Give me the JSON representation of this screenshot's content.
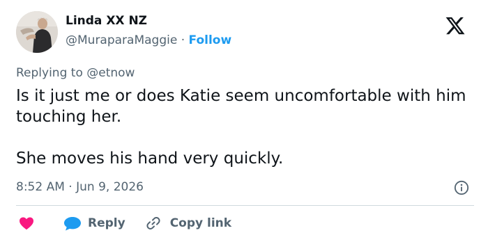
{
  "author": {
    "display_name": "Linda XX NZ",
    "handle": "@MuraparaMaggie",
    "separator": "·",
    "follow_label": "Follow"
  },
  "reply_context": {
    "text": "Replying to @etnow"
  },
  "tweet": {
    "paragraphs": [
      "Is it just me or does Katie seem uncomfortable with him touching her.",
      "She moves his hand very quickly."
    ]
  },
  "meta": {
    "time": "8:52 AM",
    "separator": "·",
    "date": "Jun 9, 2026"
  },
  "actions": {
    "like_icon": "heart-icon",
    "reply_label": "Reply",
    "copy_link_label": "Copy link"
  },
  "colors": {
    "accent": "#1d9bf0",
    "like": "#f91880",
    "text_primary": "#0f1419",
    "text_secondary": "#536471",
    "divider": "#cfd9de"
  }
}
